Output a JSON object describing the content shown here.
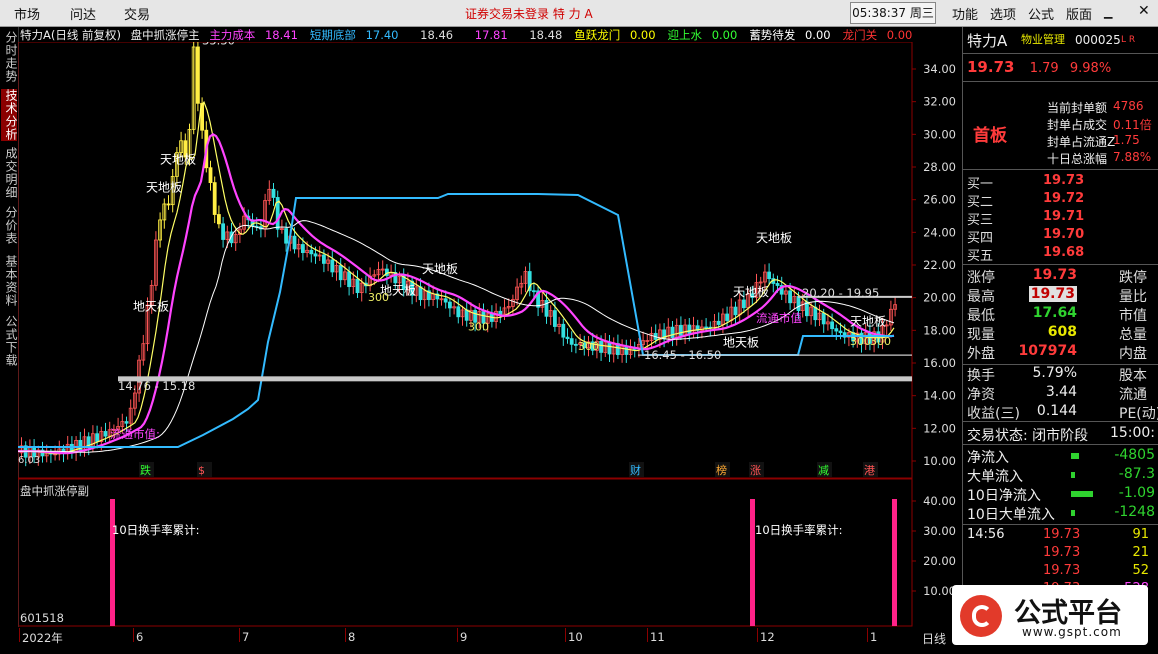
{
  "menubar": {
    "items": [
      "市场",
      "问达",
      "交易"
    ],
    "center_text": "证券交易未登录  特 力 A",
    "clock": "05:38:37 周三",
    "right_items": [
      "功能",
      "选项",
      "公式",
      "版面"
    ]
  },
  "left_tabs": [
    "分时走势",
    "技术分析",
    "成交明细",
    "分价表",
    "基本资料",
    "公式下载"
  ],
  "chart_header": {
    "name": "特力A(日线 前复权)",
    "indicator": "盘中抓涨停主",
    "items": [
      {
        "label": "主力成本",
        "value": "18.41",
        "color": "#ff44ff"
      },
      {
        "label": "短期底部",
        "value": "17.40",
        "color": "#33bbff"
      },
      {
        "label": "",
        "value": "18.46",
        "color": "#dddddd"
      },
      {
        "label": "",
        "value": "17.81",
        "color": "#ff44ff"
      },
      {
        "label": "",
        "value": "18.48",
        "color": "#dddddd"
      },
      {
        "label": "鱼跃龙门",
        "value": "0.00",
        "color": "#ffff00"
      },
      {
        "label": "迎上水",
        "value": "0.00",
        "color": "#33ff33"
      },
      {
        "label": "蓄势待发",
        "value": "0.00",
        "color": "#ffffff"
      },
      {
        "label": "龙门关",
        "value": "0.00",
        "color": "#ff3333"
      }
    ]
  },
  "price_axis": [
    "34.00",
    "32.00",
    "30.00",
    "28.00",
    "26.00",
    "24.00",
    "22.00",
    "20.00",
    "18.00",
    "16.00",
    "14.00",
    "12.00",
    "10.00"
  ],
  "sub_axis": [
    "40.00",
    "30.00",
    "20.00",
    "10.00"
  ],
  "annotations": {
    "high": "35.30",
    "low_label": "6.03",
    "range1": "14.76 - 15.18",
    "range2": "16.45 - 16.50",
    "range3": "20.20 - 19.95",
    "tian_di": "天地板",
    "di_tian": "地天板",
    "n300": "300",
    "liutong": "流通市值:",
    "liutong2": "流通市值"
  },
  "event_marks": [
    "跌",
    "$",
    "财",
    "榜",
    "涨",
    "减",
    "港"
  ],
  "sub_chart": {
    "title": "盘中抓涨停副",
    "label": "10日换手率累计:",
    "code": "601518"
  },
  "x_axis": [
    "2022年",
    "6",
    "7",
    "8",
    "9",
    "10",
    "11",
    "12",
    "1"
  ],
  "period": "日线",
  "right_panel": {
    "title": "特力A",
    "industry": "物业管理",
    "code": "000025",
    "lr": "L R",
    "price": "19.73",
    "change": "1.79",
    "pct": "9.98%",
    "first_board": "首板",
    "seal_rows": [
      {
        "label": "当前封单额",
        "value": "4786"
      },
      {
        "label": "封单占成交",
        "value": "0.11倍"
      },
      {
        "label": "封单占流通Z",
        "value": "1.75"
      },
      {
        "label": "十日总涨幅",
        "value": "7.88%"
      }
    ],
    "bids": [
      {
        "label": "买一",
        "price": "19.73"
      },
      {
        "label": "买二",
        "price": "19.72"
      },
      {
        "label": "买三",
        "price": "19.71"
      },
      {
        "label": "买四",
        "price": "19.70"
      },
      {
        "label": "买五",
        "price": "19.68"
      }
    ],
    "stats": [
      {
        "l1": "涨停",
        "v1": "19.73",
        "l2": "跌停"
      },
      {
        "l1": "最高",
        "v1": "19.73",
        "l2": "量比"
      },
      {
        "l1": "最低",
        "v1": "17.64",
        "l2": "市值"
      },
      {
        "l1": "现量",
        "v1": "608",
        "l2": "总量"
      },
      {
        "l1": "外盘",
        "v1": "107974",
        "l2": "内盘"
      }
    ],
    "stats2": [
      {
        "l1": "换手",
        "v1": "5.79%",
        "l2": "股本"
      },
      {
        "l1": "净资",
        "v1": "3.44",
        "l2": "流通"
      },
      {
        "l1": "收益(三)",
        "v1": "0.144",
        "l2": "PE(动)"
      }
    ],
    "trade_status": "交易状态: 闭市阶段",
    "trade_time": "15:00:",
    "flows": [
      {
        "label": "净流入",
        "value": "-4805"
      },
      {
        "label": "大单流入",
        "value": "-87.3"
      },
      {
        "label": "10日净流入",
        "value": "-1.09"
      },
      {
        "label": "10日大单流入",
        "value": "-1248"
      }
    ],
    "ticks": [
      {
        "time": "14:56",
        "price": "19.73",
        "vol": "91"
      },
      {
        "time": "",
        "price": "19.73",
        "vol": "21"
      },
      {
        "time": "",
        "price": "19.73",
        "vol": "52"
      },
      {
        "time": "",
        "price": "19.73",
        "vol": "528"
      }
    ]
  },
  "logo": {
    "text": "公式平台",
    "url": "www.gspt.com"
  }
}
